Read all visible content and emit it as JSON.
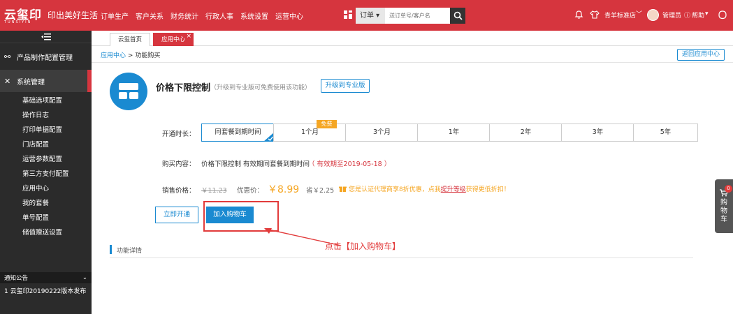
{
  "brand": {
    "name": "云玺印",
    "sub": "TUNSIYIN",
    "slogan": "印出美好生活"
  },
  "nav": [
    "订单生产",
    "客户关系",
    "财务统计",
    "行政人事",
    "系统设置",
    "运营中心"
  ],
  "search": {
    "type_label": "订单",
    "placeholder": "送订单号/客户名"
  },
  "topright": {
    "store": "青羊标准店",
    "user": "管理员",
    "help": "帮助"
  },
  "sidebar": {
    "groups": [
      {
        "label": "产品制作配置管理"
      },
      {
        "label": "系统管理"
      }
    ],
    "items": [
      "基础选项配置",
      "操作日志",
      "打印单据配置",
      "门店配置",
      "运营参数配置",
      "第三方支付配置",
      "应用中心",
      "我的套餐",
      "单号配置",
      "储值赠送设置"
    ],
    "notice_title": "通知公告",
    "notice_item": "1 云玺印20190222版本发布"
  },
  "tabs": [
    {
      "label": "云玺首页"
    },
    {
      "label": "应用中心"
    }
  ],
  "breadcrumb": {
    "parent": "应用中心",
    "sep": ">",
    "current": "功能购买"
  },
  "back_button": "返回应用中心",
  "product": {
    "title": "价格下限控制",
    "note": "（升级到专业版可免费使用该功能）",
    "upgrade": "升级到专业版"
  },
  "duration": {
    "label": "开通时长：",
    "options": [
      "同套餐到期时间",
      "1个月",
      "3个月",
      "1年",
      "2年",
      "3年",
      "5年"
    ],
    "selected": "同套餐到期时间",
    "free_badge": "免费"
  },
  "purchase": {
    "label": "购买内容：",
    "value": "价格下限控制 有效期同套餐到期时间",
    "validity": "（ 有效期至2019-05-18 ）"
  },
  "price": {
    "label": "销售价格：",
    "original": "￥11.23",
    "discount_label": "优惠价：",
    "discount": "￥8.99",
    "save": "省￥2.25",
    "promo_pre": "您是认证代理商享8折优惠，点我",
    "promo_link": "提升等级",
    "promo_post": "获得更低折扣！"
  },
  "buttons": {
    "open": "立即开通",
    "add_cart": "加入购物车"
  },
  "annotation": "点击【加入购物车】",
  "section": "功能详情",
  "float_cart": {
    "count": "0",
    "label": "购物车"
  },
  "colors": {
    "brand_red": "#d6353e",
    "link_blue": "#1a8ad1",
    "orange": "#f5a623"
  }
}
